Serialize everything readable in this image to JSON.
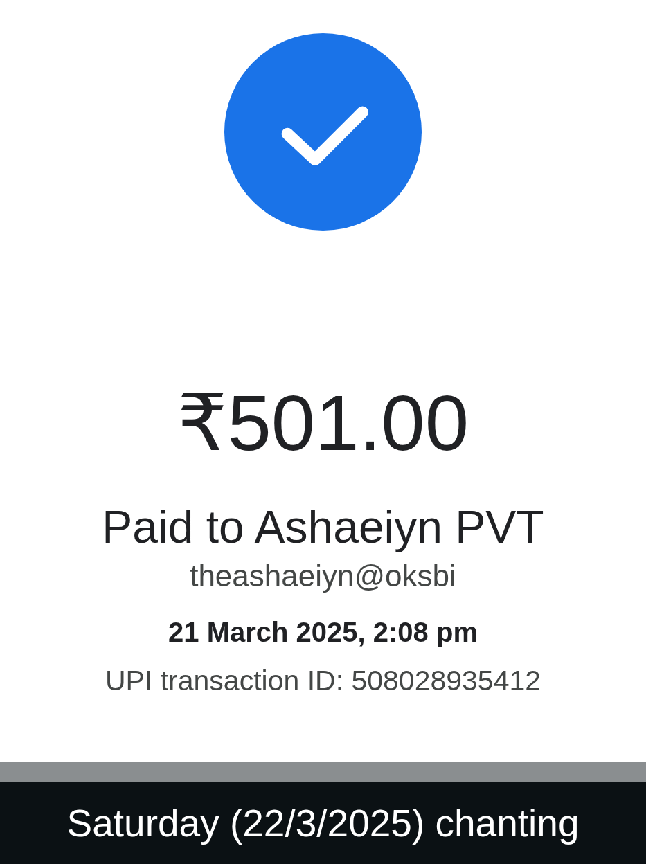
{
  "payment": {
    "amount": "₹501.00",
    "payee": "Paid to Ashaeiyn PVT",
    "upi_id": "theashaeiyn@oksbi",
    "datetime": "21 March 2025, 2:08 pm",
    "transaction_id": "UPI transaction ID: 508028935412"
  },
  "caption": "Saturday (22/3/2025) chanting"
}
